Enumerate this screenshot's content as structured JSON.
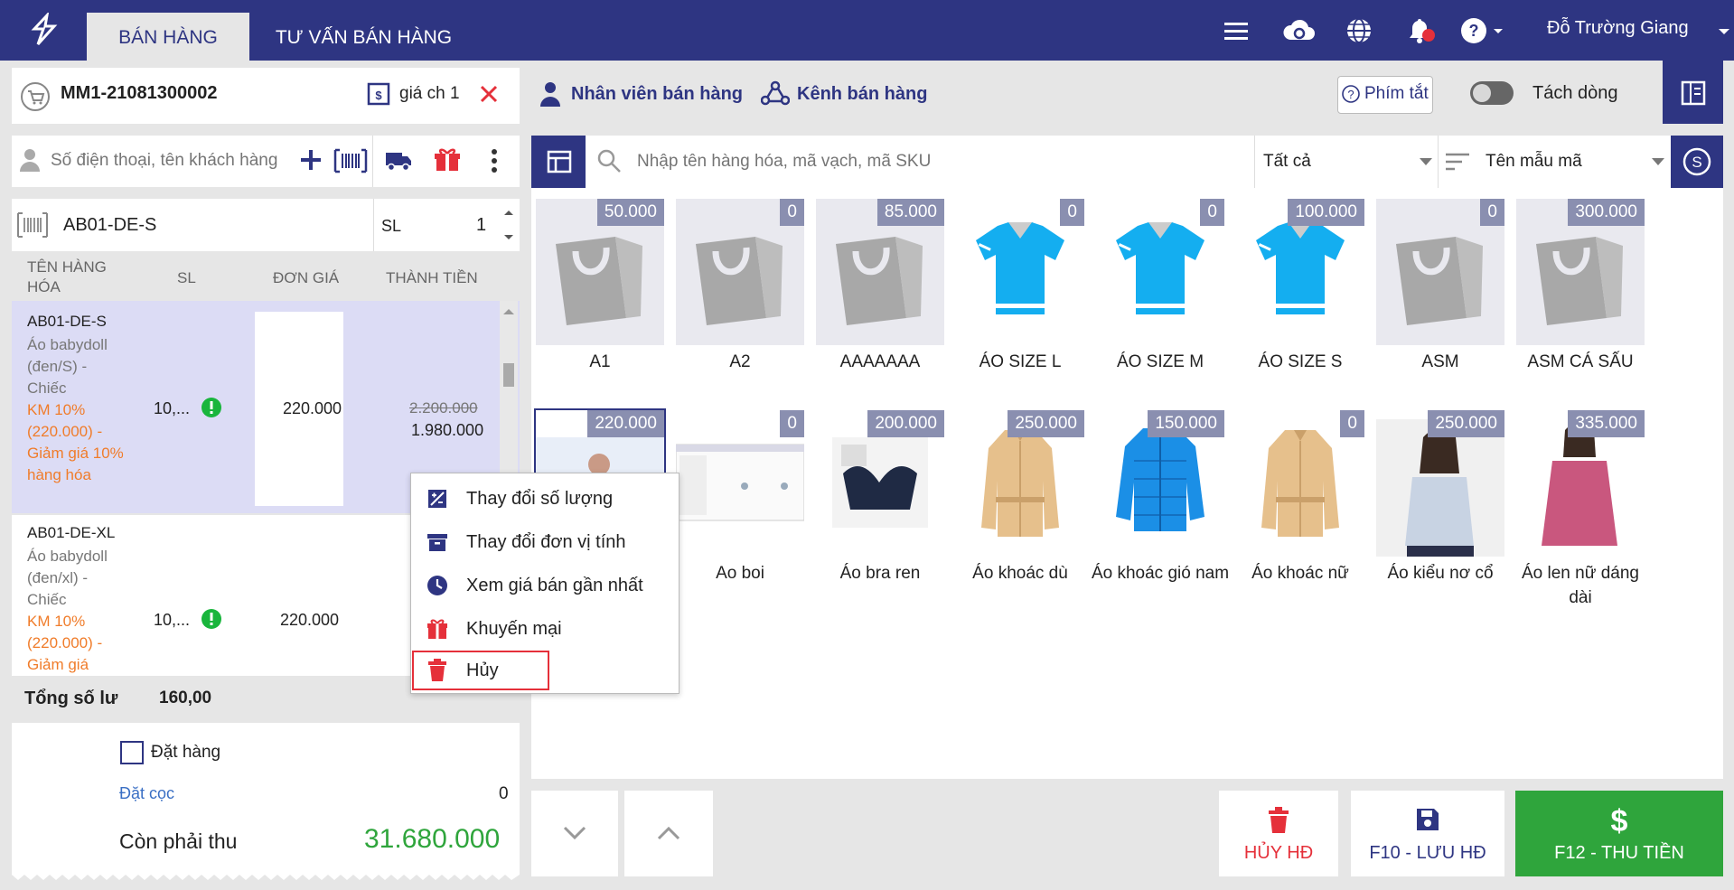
{
  "tabs": [
    "BÁN HÀNG",
    "TƯ VẤN BÁN HÀNG"
  ],
  "user": "Đỗ Trường Giang",
  "invoice": {
    "code": "MM1-21081300002",
    "price_list": "giá ch 1",
    "staff_label": "Nhân viên bán hàng",
    "channel_label": "Kênh bán hàng",
    "shortcut_label": "Phím tắt",
    "split_label": "Tách dòng"
  },
  "customer": {
    "placeholder": "Số điện thoại, tên khách hàng"
  },
  "scan": {
    "code": "AB01-DE-S",
    "qty_label": "SL",
    "qty": "1"
  },
  "cart": {
    "headers": [
      "TÊN HÀNG HÓA",
      "SL",
      "ĐƠN GIÁ",
      "THÀNH TIỀN"
    ],
    "items": [
      {
        "code": "AB01-DE-S",
        "desc": "Áo babydoll (đen/S) - Chiếc",
        "promo": "KM 10% (220.000) - Giảm giá 10% hàng hóa",
        "qty": "10,...",
        "price": "220.000",
        "old_total": "2.200.000",
        "total": "1.980.000"
      },
      {
        "code": "AB01-DE-XL",
        "desc": "Áo babydoll (đen/xl) - Chiếc",
        "promo": "KM 10% (220.000) - Giảm giá",
        "qty": "10,...",
        "price": "220.000"
      }
    ],
    "total_label": "Tổng số lư",
    "total_value": "160,00"
  },
  "summary": {
    "order_label": "Đặt hàng",
    "deposit_label": "Đặt cọc",
    "deposit_value": "0",
    "remaining_label": "Còn phải thu",
    "remaining_value": "31.680.000"
  },
  "search": {
    "placeholder": "Nhập tên hàng hóa, mã vạch, mã SKU",
    "filter": "Tất cả",
    "sort": "Tên mẫu mã"
  },
  "products": [
    {
      "name": "A1",
      "price": "50.000",
      "icon": "bag"
    },
    {
      "name": "A2",
      "price": "0",
      "icon": "bag"
    },
    {
      "name": "AAAAAAA",
      "price": "85.000",
      "icon": "bag"
    },
    {
      "name": "ÁO SIZE L",
      "price": "0",
      "icon": "shirt"
    },
    {
      "name": "ÁO SIZE M",
      "price": "0",
      "icon": "shirt"
    },
    {
      "name": "ÁO SIZE S",
      "price": "100.000",
      "icon": "shirt"
    },
    {
      "name": "ASM",
      "price": "0",
      "icon": "bag"
    },
    {
      "name": "ASM CÁ SẤU",
      "price": "300.000",
      "icon": "bag"
    },
    {
      "name": "",
      "price": "220.000",
      "icon": "photo-girl"
    },
    {
      "name": "Ao boi",
      "price": "0",
      "icon": "screenshot"
    },
    {
      "name": "Áo bra ren",
      "price": "200.000",
      "icon": "photo-bra"
    },
    {
      "name": "Áo khoác dù",
      "price": "250.000",
      "icon": "coat"
    },
    {
      "name": "Áo khoác gió nam",
      "price": "150.000",
      "icon": "jacket"
    },
    {
      "name": "Áo khoác nữ",
      "price": "0",
      "icon": "coat"
    },
    {
      "name": "Áo kiểu nơ cổ",
      "price": "250.000",
      "icon": "photo-woman"
    },
    {
      "name": "Áo len nữ dáng dài",
      "price": "335.000",
      "icon": "photo-pink"
    }
  ],
  "context_menu": [
    "Thay đổi số lượng",
    "Thay đổi đơn vị tính",
    "Xem giá bán gần nhất",
    "Khuyến mại",
    "Hủy"
  ],
  "buttons": {
    "cancel": "HỦY HĐ",
    "save": "F10 - LƯU HĐ",
    "pay": "F12 - THU TIỀN"
  },
  "colors": {
    "nav": "#2e3582",
    "accent_red": "#e5303a",
    "pay_green": "#2fa53c",
    "price_tag": "#8a8fb0",
    "promo": "#f07c2a"
  }
}
